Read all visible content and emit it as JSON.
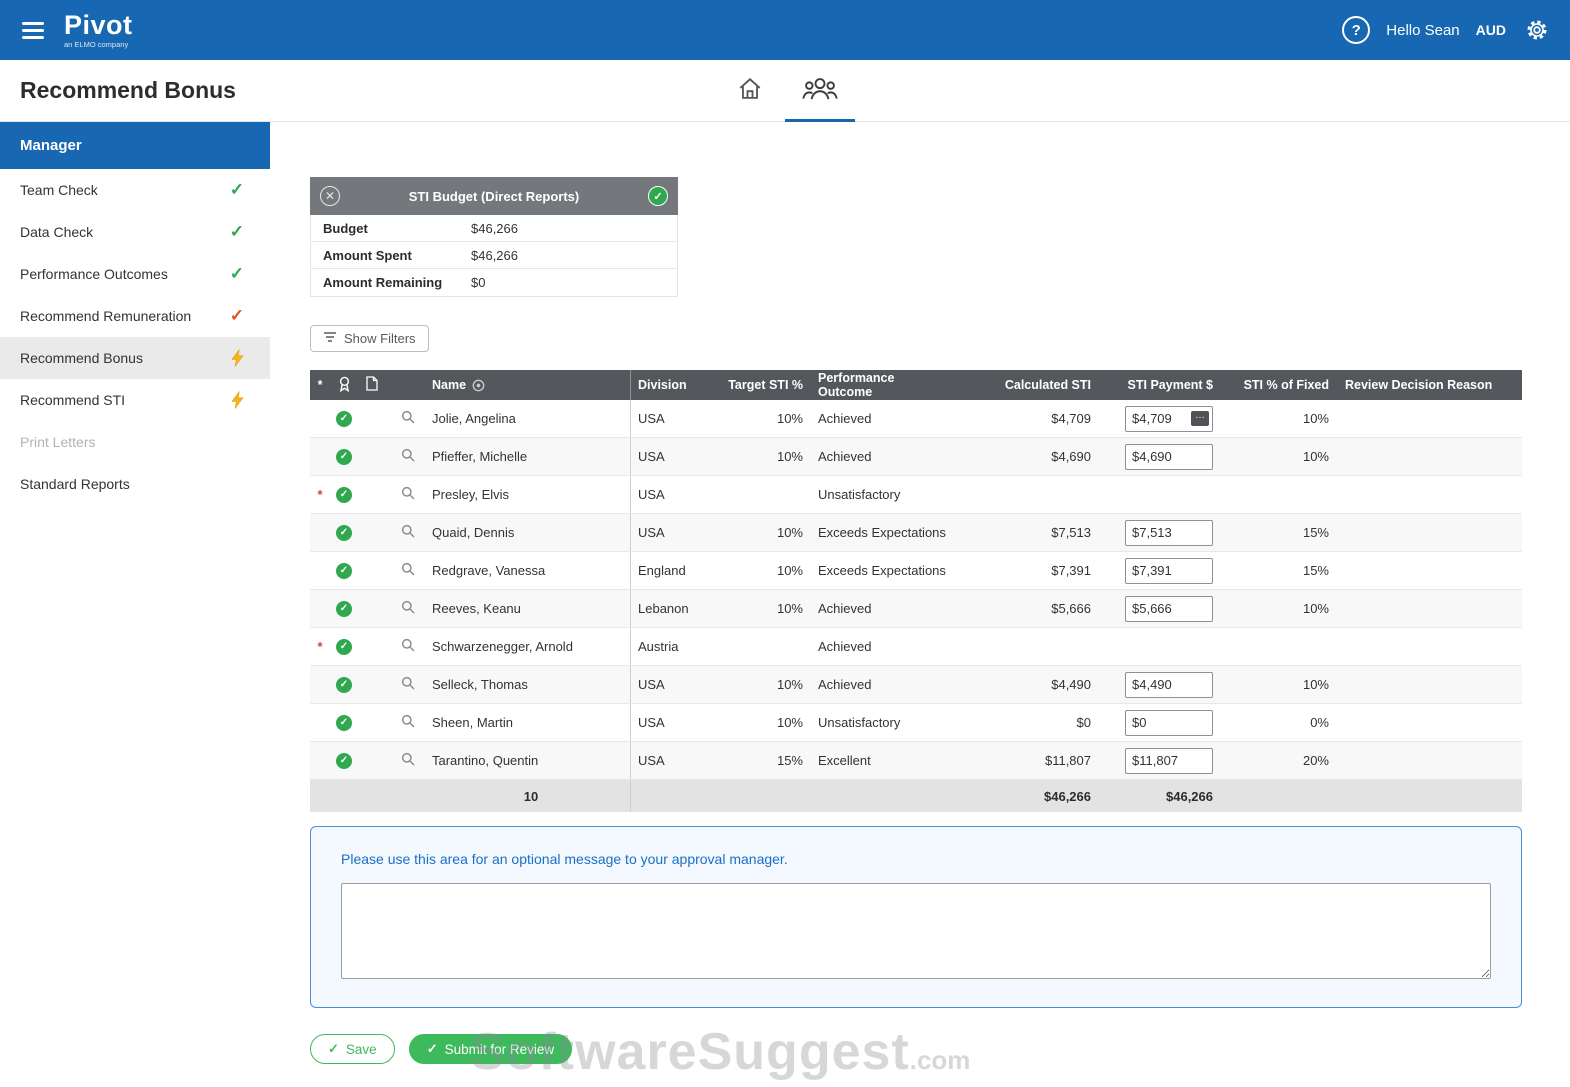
{
  "topbar": {
    "brand": "Pivot",
    "brand_sub": "an ELMO company",
    "greeting": "Hello Sean",
    "currency": "AUD"
  },
  "header": {
    "title": "Recommend Bonus"
  },
  "sidebar": {
    "header": "Manager",
    "items": [
      {
        "label": "Team Check",
        "status": "check-green",
        "active": false,
        "disabled": false
      },
      {
        "label": "Data Check",
        "status": "check-green",
        "active": false,
        "disabled": false
      },
      {
        "label": "Performance Outcomes",
        "status": "check-green",
        "active": false,
        "disabled": false
      },
      {
        "label": "Recommend Remuneration",
        "status": "check-orange",
        "active": false,
        "disabled": false
      },
      {
        "label": "Recommend Bonus",
        "status": "bolt",
        "active": true,
        "disabled": false
      },
      {
        "label": "Recommend STI",
        "status": "bolt",
        "active": false,
        "disabled": false
      },
      {
        "label": "Print Letters",
        "status": "none",
        "active": false,
        "disabled": true
      },
      {
        "label": "Standard Reports",
        "status": "none",
        "active": false,
        "disabled": false
      }
    ]
  },
  "budget_panel": {
    "title": "STI Budget (Direct Reports)",
    "rows": [
      {
        "label": "Budget",
        "value": "$46,266"
      },
      {
        "label": "Amount Spent",
        "value": "$46,266"
      },
      {
        "label": "Amount Remaining",
        "value": "$0"
      }
    ]
  },
  "filters": {
    "show_filters_label": "Show Filters"
  },
  "table": {
    "headers": {
      "star": "*",
      "name": "Name",
      "division": "Division",
      "target_sti": "Target STI %",
      "outcome": "Performance Outcome",
      "calculated": "Calculated STI",
      "payment": "STI Payment $",
      "pct_fixed": "STI % of Fixed",
      "reason": "Review Decision Reason"
    },
    "rows": [
      {
        "required": false,
        "name": "Jolie, Angelina",
        "division": "USA",
        "target": "10%",
        "outcome": "Achieved",
        "calculated": "$4,709",
        "payment": "$4,709",
        "pct_fixed": "10%",
        "ellipsis": true,
        "reason": ""
      },
      {
        "required": false,
        "name": "Pfieffer, Michelle",
        "division": "USA",
        "target": "10%",
        "outcome": "Achieved",
        "calculated": "$4,690",
        "payment": "$4,690",
        "pct_fixed": "10%",
        "ellipsis": false,
        "reason": ""
      },
      {
        "required": true,
        "name": "Presley, Elvis",
        "division": "USA",
        "target": "",
        "outcome": "Unsatisfactory",
        "calculated": "",
        "payment": null,
        "pct_fixed": "",
        "ellipsis": false,
        "reason": ""
      },
      {
        "required": false,
        "name": "Quaid, Dennis",
        "division": "USA",
        "target": "10%",
        "outcome": "Exceeds Expectations",
        "calculated": "$7,513",
        "payment": "$7,513",
        "pct_fixed": "15%",
        "ellipsis": false,
        "reason": ""
      },
      {
        "required": false,
        "name": "Redgrave, Vanessa",
        "division": "England",
        "target": "10%",
        "outcome": "Exceeds Expectations",
        "calculated": "$7,391",
        "payment": "$7,391",
        "pct_fixed": "15%",
        "ellipsis": false,
        "reason": ""
      },
      {
        "required": false,
        "name": "Reeves, Keanu",
        "division": "Lebanon",
        "target": "10%",
        "outcome": "Achieved",
        "calculated": "$5,666",
        "payment": "$5,666",
        "pct_fixed": "10%",
        "ellipsis": false,
        "reason": ""
      },
      {
        "required": true,
        "name": "Schwarzenegger, Arnold",
        "division": "Austria",
        "target": "",
        "outcome": "Achieved",
        "calculated": "",
        "payment": null,
        "pct_fixed": "",
        "ellipsis": false,
        "reason": ""
      },
      {
        "required": false,
        "name": "Selleck, Thomas",
        "division": "USA",
        "target": "10%",
        "outcome": "Achieved",
        "calculated": "$4,490",
        "payment": "$4,490",
        "pct_fixed": "10%",
        "ellipsis": false,
        "reason": ""
      },
      {
        "required": false,
        "name": "Sheen, Martin",
        "division": "USA",
        "target": "10%",
        "outcome": "Unsatisfactory",
        "calculated": "$0",
        "payment": "$0",
        "pct_fixed": "0%",
        "ellipsis": false,
        "reason": ""
      },
      {
        "required": false,
        "name": "Tarantino, Quentin",
        "division": "USA",
        "target": "15%",
        "outcome": "Excellent",
        "calculated": "$11,807",
        "payment": "$11,807",
        "pct_fixed": "20%",
        "ellipsis": false,
        "reason": ""
      }
    ],
    "footer": {
      "count": "10",
      "calculated_total": "$46,266",
      "payment_total": "$46,266"
    }
  },
  "message": {
    "prompt": "Please use this area for an optional message to your approval manager.",
    "value": ""
  },
  "actions": {
    "save": "Save",
    "submit": "Submit for Review"
  },
  "watermark": {
    "text": "SoftwareSuggest",
    "suffix": ".com"
  },
  "colors": {
    "accent_blue": "#1767b2",
    "dark_header": "#54585c",
    "panel_header": "#74787c",
    "green": "#2fa84f",
    "green_button": "#3cba5c",
    "orange_check": "#e0551f",
    "bolt_yellow": "#f9b517",
    "message_border": "#4a90d9",
    "message_bg": "#f3f9ff",
    "message_text": "#1a6fc4"
  }
}
